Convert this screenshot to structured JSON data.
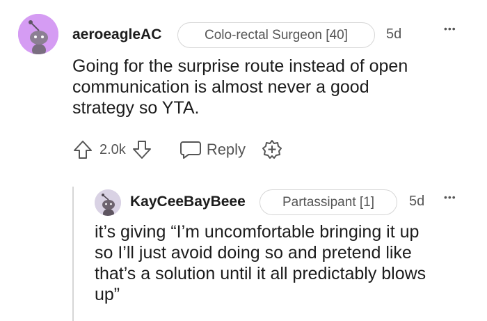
{
  "comment": {
    "username": "aeroeagleAC",
    "flair": "Colo-rectal Surgeon [40]",
    "age": "5d",
    "more_label": "•••",
    "body_lines": [
      "Going for the surprise route instead of open",
      "communication is almost never a good",
      "strategy so YTA."
    ],
    "votes": "2.0k",
    "reply_label": "Reply"
  },
  "reply": {
    "username": "KayCeeBayBeee",
    "flair": "Partassipant [1]",
    "age": "5d",
    "more_label": "•••",
    "body_lines": [
      "it’s giving “I’m uncomfortable bringing it up",
      "so I’ll just avoid doing so and pretend like",
      "that’s a solution until it all predictably blows",
      "up”"
    ]
  },
  "colors": {
    "avatar1_bg": "#d59cf3",
    "avatar2_bg": "#d9d2e4",
    "icon_gray": "#555555",
    "border": "#d6d6d6"
  }
}
